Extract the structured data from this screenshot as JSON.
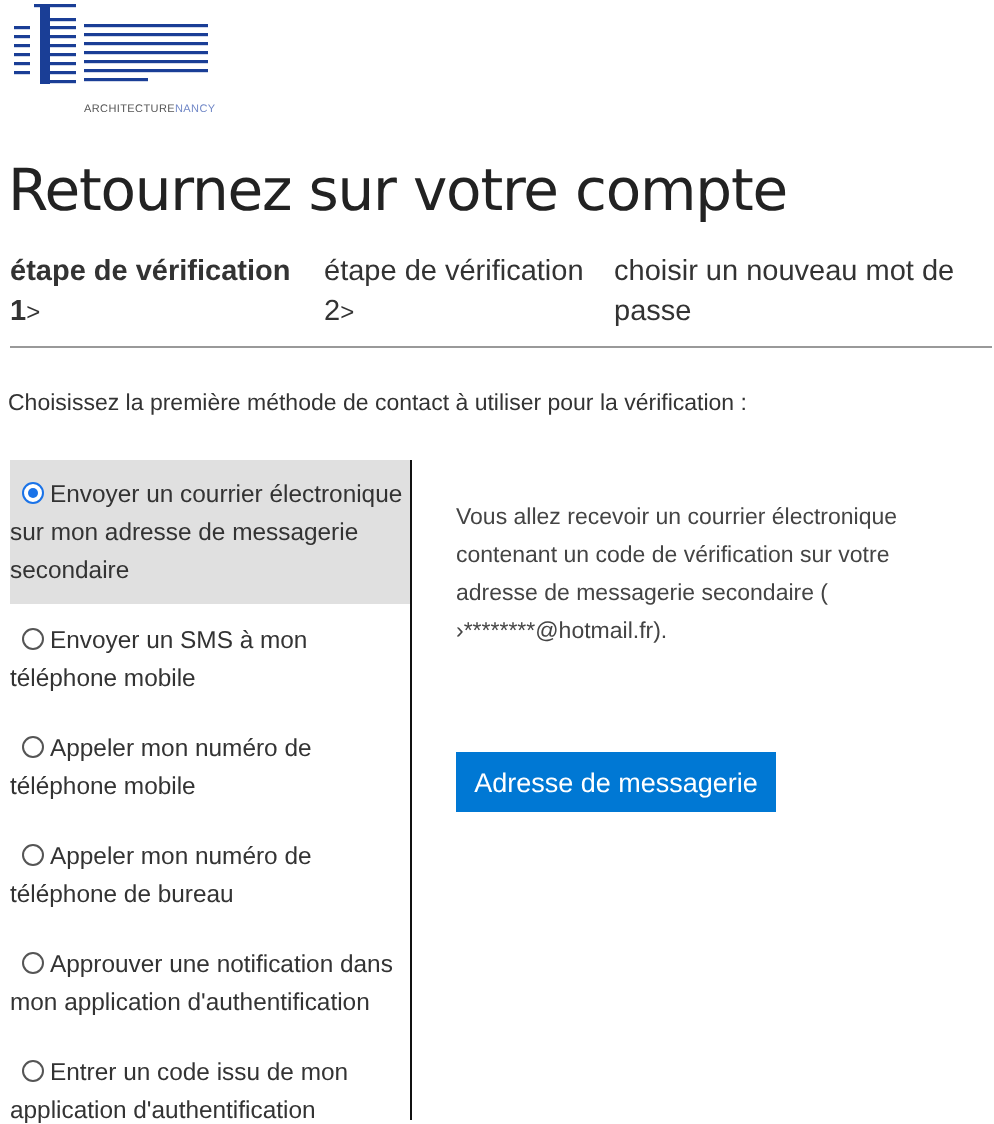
{
  "logo": {
    "text": "ARCHITECTURE",
    "accent": "NANCY"
  },
  "title": "Retournez sur votre compte",
  "steps": [
    {
      "label": "étape de vérification 1",
      "arrow": ">",
      "selected": true
    },
    {
      "label": "étape de vérification 2",
      "arrow": ">",
      "selected": false
    },
    {
      "label": "choisir un nouveau mot de passe",
      "selected": false
    }
  ],
  "instruction": "Choisissez la première méthode de contact à utiliser pour la vérification :",
  "options": [
    {
      "label": "Envoyer un courrier électronique sur mon adresse de messagerie secondaire",
      "selected": true
    },
    {
      "label": "Envoyer un SMS à mon téléphone mobile",
      "selected": false
    },
    {
      "label": "Appeler mon numéro de téléphone mobile",
      "selected": false
    },
    {
      "label": "Appeler mon numéro de téléphone de bureau",
      "selected": false
    },
    {
      "label": "Approuver une notification dans mon application d'authentification",
      "selected": false
    },
    {
      "label": "Entrer un code issu de mon application d'authentification",
      "selected": false
    }
  ],
  "description": "Vous allez recevoir un courrier électronique contenant un code de vérification sur votre adresse de messagerie secondaire (    ›********@hotmail.fr).",
  "button": "Adresse de messagerie"
}
